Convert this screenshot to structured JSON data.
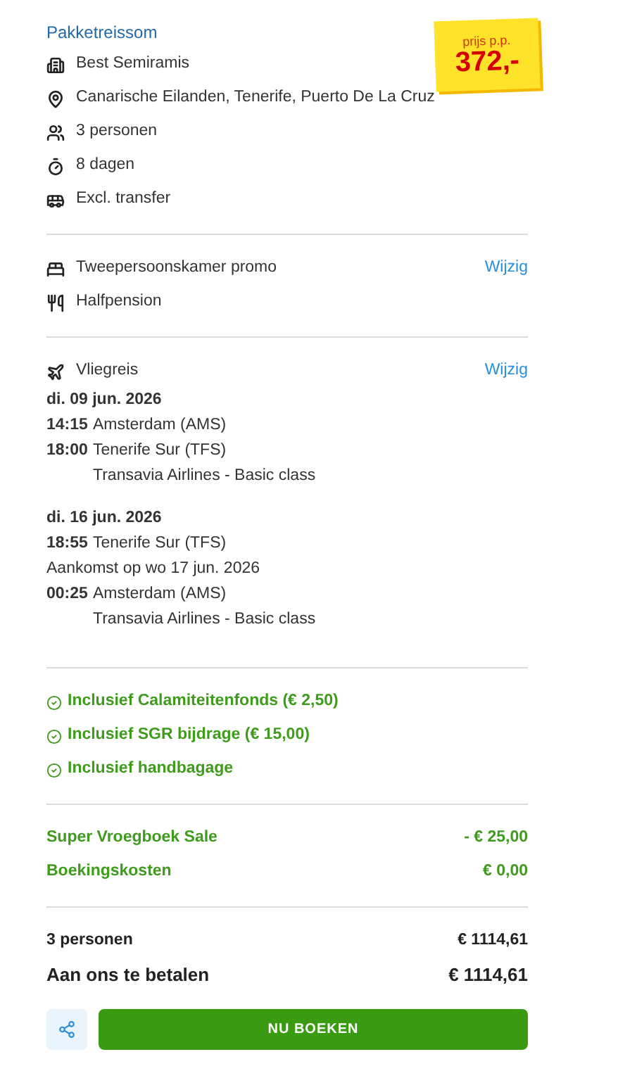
{
  "title": "Pakketreissom",
  "price_sticker": {
    "label": "prijs p.p.",
    "price": "372,-"
  },
  "details": [
    {
      "kind": "hotel",
      "text": "Best Semiramis"
    },
    {
      "kind": "location",
      "text": "Canarische Eilanden, Tenerife, Puerto De La Cruz"
    },
    {
      "kind": "persons",
      "text": "3 personen"
    },
    {
      "kind": "duration",
      "text": "8 dagen"
    },
    {
      "kind": "transfer",
      "text": "Excl. transfer"
    }
  ],
  "room": [
    {
      "kind": "bed",
      "text": "Tweepersoonskamer promo",
      "action": "Wijzig"
    },
    {
      "kind": "meal",
      "text": "Halfpension"
    }
  ],
  "flight": {
    "label": "Vliegreis",
    "action": "Wijzig",
    "legs": [
      {
        "date": "di. 09 jun. 2026",
        "lines": [
          {
            "kind": "time",
            "time": "14:15",
            "text": "Amsterdam (AMS)"
          },
          {
            "kind": "time",
            "time": "18:00",
            "text": "Tenerife Sur (TFS)"
          },
          {
            "kind": "carrier",
            "text": "Transavia Airlines - Basic class"
          }
        ]
      },
      {
        "date": "di. 16 jun. 2026",
        "lines": [
          {
            "kind": "time",
            "time": "18:55",
            "text": "Tenerife Sur (TFS)"
          },
          {
            "kind": "note",
            "text": "Aankomst op wo 17 jun. 2026"
          },
          {
            "kind": "time",
            "time": "00:25",
            "text": "Amsterdam (AMS)"
          },
          {
            "kind": "carrier",
            "text": "Transavia Airlines - Basic class"
          }
        ]
      }
    ]
  },
  "included": [
    "Inclusief Calamiteitenfonds (€ 2,50)",
    "Inclusief SGR bijdrage (€ 15,00)",
    "Inclusief handbagage"
  ],
  "costs": [
    {
      "label": "Super Vroegboek Sale",
      "amount": "- € 25,00"
    },
    {
      "label": "Boekingskosten",
      "amount": "€ 0,00"
    }
  ],
  "totals": [
    {
      "kind": "normal",
      "label": "3 personen",
      "amount": "€ 1114,61"
    },
    {
      "kind": "grand",
      "label": "Aan ons te betalen",
      "amount": "€ 1114,61"
    }
  ],
  "book_button": "NU BOEKEN"
}
